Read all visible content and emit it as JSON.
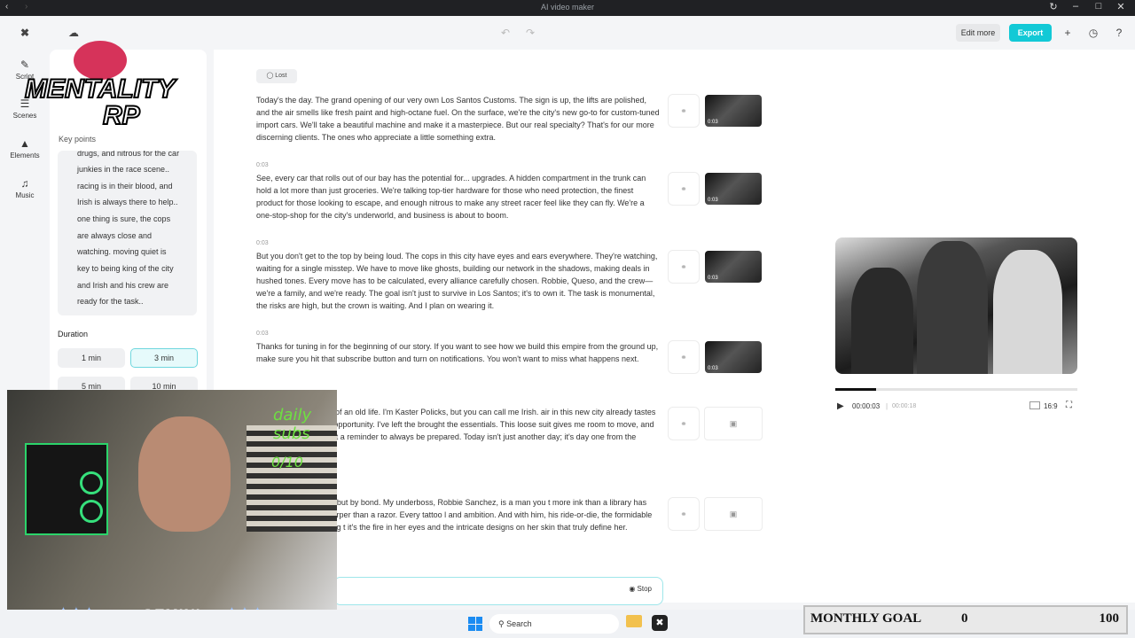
{
  "window": {
    "title": "AI video maker"
  },
  "toolbar": {
    "edit_more": "Edit more",
    "export": "Export"
  },
  "rail": [
    {
      "label": "Script",
      "icon": "script-icon"
    },
    {
      "label": "Scenes",
      "icon": "scenes-icon"
    },
    {
      "label": "Elements",
      "icon": "elements-icon"
    },
    {
      "label": "Music",
      "icon": "music-icon"
    }
  ],
  "left_panel": {
    "key_points_label": "Key points",
    "key_points_lines": [
      "drugs, and nitrous for the car",
      "junkies in the race scene..",
      "racing is in their blood, and",
      "Irish is always there to help..",
      "one thing is sure, the cops",
      "are always close and",
      "watching. moving quiet is",
      "key to being king of the city",
      "and Irish and his crew are",
      "ready for the task.."
    ],
    "duration_label": "Duration",
    "durations": [
      "1 min",
      "3 min",
      "5 min",
      "10 min"
    ],
    "selected_duration": "3 min"
  },
  "script": {
    "lost_label": "Lost",
    "paragraphs": [
      {
        "timestamp": "",
        "text": "Today's the day. The grand opening of our very own Los Santos Customs. The sign is up, the lifts are polished, and the air smells like fresh paint and high-octane fuel. On the surface, we're the city's new go-to for custom-tuned import cars. We'll take a beautiful machine and make it a masterpiece. But our real specialty? That's for our more discerning clients. The ones who appreciate a little something extra.",
        "thumb_time": "0:03"
      },
      {
        "timestamp": "0:03",
        "text": "See, every car that rolls out of our bay has the potential for... upgrades. A hidden compartment in the trunk can hold a lot more than just groceries. We're talking top-tier hardware for those who need protection, the finest product for those looking to escape, and enough nitrous to make any street racer feel like they can fly. We're a one-stop-shop for the city's underworld, and business is about to boom.",
        "thumb_time": "0:03"
      },
      {
        "timestamp": "0:03",
        "text": "But you don't get to the top by being loud. The cops in this city have eyes and ears everywhere. They're watching, waiting for a single misstep. We have to move like ghosts, building our network in the shadows, making deals in hushed tones. Every move has to be calculated, every alliance carefully chosen. Robbie, Queso, and the crew—we're a family, and we're ready. The goal isn't just to survive in Los Santos; it's to own it. The task is monumental, the risks are high, but the crown is waiting. And I plan on wearing it.",
        "thumb_time": "0:03"
      },
      {
        "timestamp": "0:03",
        "text": "Thanks for tuning in for the beginning of our story. If you want to see how we build this empire from the ground up, make sure you hit that subscribe button and turn on notifications. You won't want to miss what happens next.",
        "thumb_time": "0:03"
      },
      {
        "timestamp": "",
        "text": "with the last footsteps of an old life. I'm Kaster Policks, but you can call me Irish. air in this new city already tastes different. It tastes like opportunity. I've left the brought the essentials. This loose suit gives me room to move, and this old Colt on at's just a reminder to always be prepared. Today isn't just another day; it's day one from the ground up.",
        "thumb_time": ""
      },
      {
        "timestamp": "",
        "text": "e family. Not by blood, but by bond. My underboss, Robbie Sanchez, is a man you t more ink than a library has books, and a mind sharper than a razor. Every tattoo l and ambition. And with him, his ride-or-die, the formidable Queso Blanca. Her long t it's the fire in her eyes and the intricate designs on her skin that truly define her.",
        "thumb_time": ""
      }
    ],
    "stop_label": "Stop"
  },
  "player": {
    "current_time": "00:00:03",
    "total_time": "00:00:18",
    "progress": 0.167,
    "aspect_ratio": "16:9"
  },
  "overlay": {
    "logo_line1": "MENTALITY",
    "logo_line2": "RP",
    "daily_subs": "daily subs",
    "subs_count": "0/10",
    "streamer_tag": "GEMINI"
  },
  "taskbar": {
    "search_placeholder": "Search"
  },
  "goal": {
    "label": "MONTHLY GOAL",
    "current": "0",
    "target": "100"
  }
}
